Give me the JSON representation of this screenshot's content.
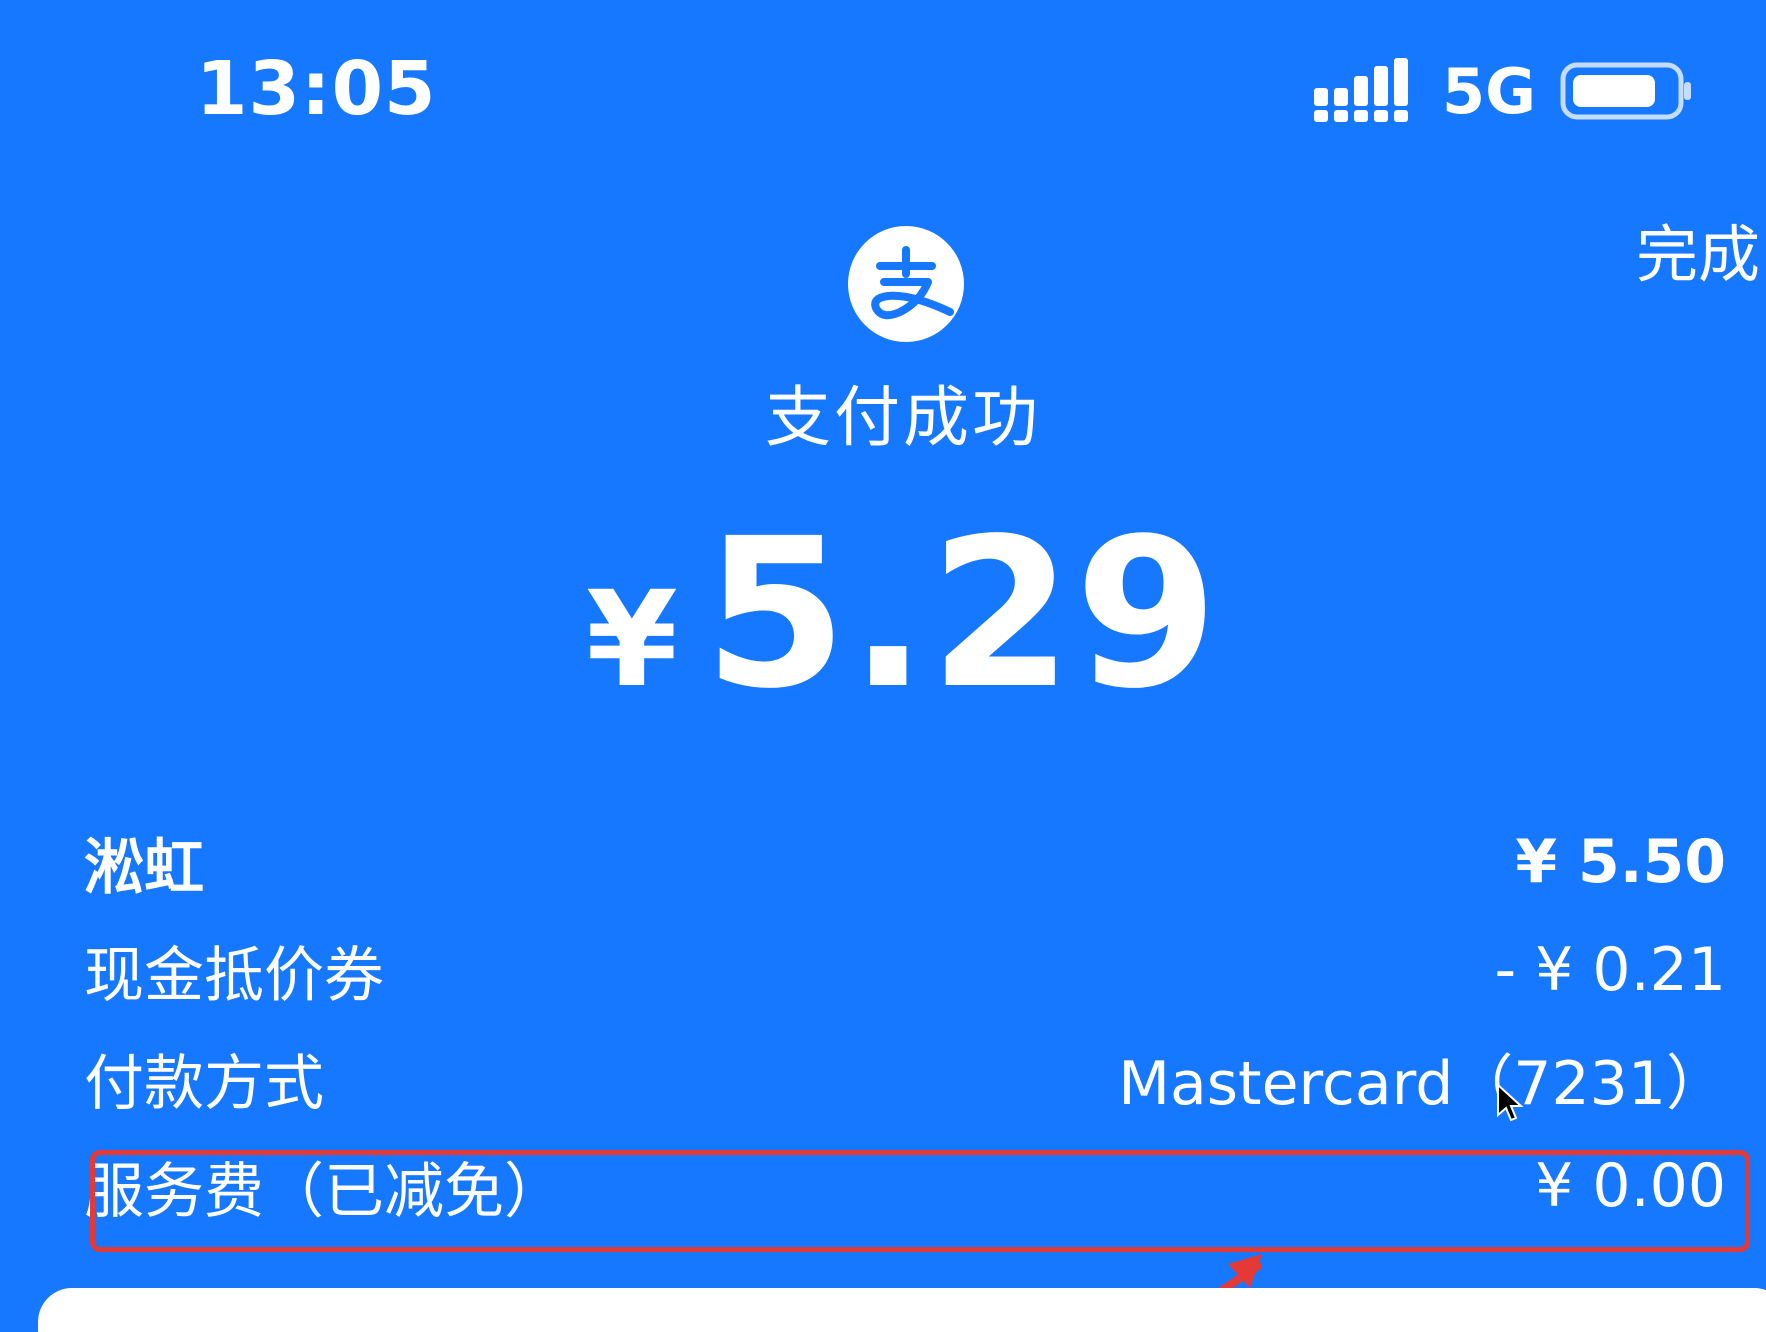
{
  "status_bar": {
    "time": "13:05",
    "network": "5G",
    "signal_icon": "signal-bars-icon",
    "battery_icon": "battery-icon"
  },
  "header": {
    "done_label": "完成"
  },
  "result": {
    "logo_icon": "alipay-logo-icon",
    "title": "支付成功",
    "currency": "¥",
    "amount": "5.29"
  },
  "details": [
    {
      "label": "淞虹",
      "value": "¥ 5.50",
      "emphasis": true
    },
    {
      "label": "现金抵价券",
      "value": "- ¥ 0.21",
      "emphasis": false
    },
    {
      "label": "付款方式",
      "value": "Mastercard（7231）",
      "emphasis": false
    },
    {
      "label": "服务费（已减免）",
      "value": "¥ 0.00",
      "emphasis": false
    }
  ],
  "annotation": {
    "highlight_color": "#e53935",
    "arrow_icon": "red-arrow-icon"
  },
  "colors": {
    "background": "#1677ff",
    "text": "#ffffff",
    "card": "#ffffff"
  }
}
